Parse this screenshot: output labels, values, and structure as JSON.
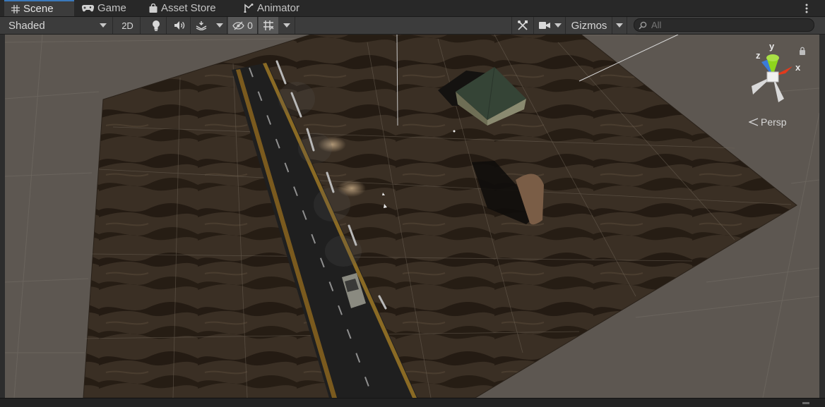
{
  "tabs": [
    {
      "label": "Scene",
      "icon": "grid-icon",
      "active": true
    },
    {
      "label": "Game",
      "icon": "gamepad-icon",
      "active": false
    },
    {
      "label": "Asset Store",
      "icon": "shopping-bag-icon",
      "active": false
    },
    {
      "label": "Animator",
      "icon": "animator-icon",
      "active": false
    }
  ],
  "toolbar": {
    "draw_mode": "Shaded",
    "mode_2d": "2D",
    "hidden_count": "0",
    "gizmos": "Gizmos",
    "search_placeholder": "All"
  },
  "gizmo": {
    "axis_x": "x",
    "axis_y": "y",
    "axis_z": "z",
    "projection": "Persp"
  },
  "colors": {
    "accent": "#3a79bb",
    "toolbar_bg": "#3c3c3c",
    "skybox": "#5d5751",
    "axis_x": "#e23a1c",
    "axis_y": "#8ed41c",
    "axis_z": "#3b7bd8"
  }
}
